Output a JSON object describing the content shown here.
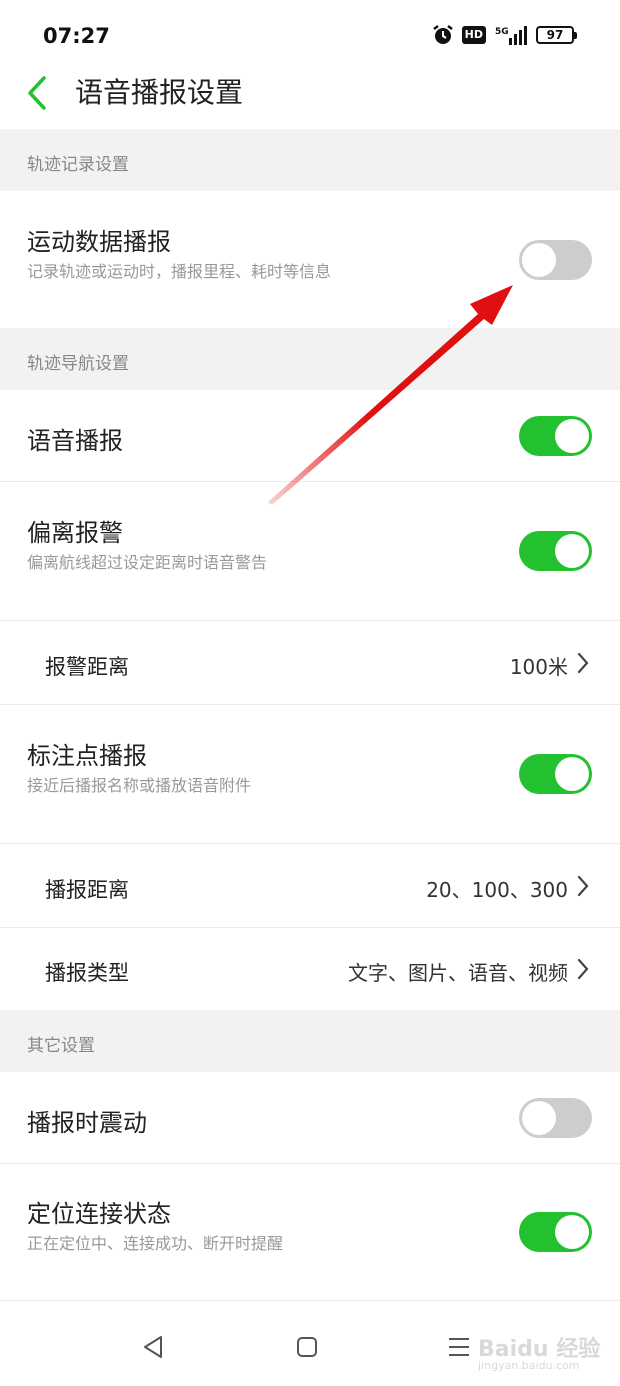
{
  "status_bar": {
    "time": "07:27",
    "hd_label": "HD",
    "network_label": "5G",
    "battery_level": "97"
  },
  "header": {
    "title": "语音播报设置"
  },
  "sections": {
    "track_record": "轨迹记录设置",
    "track_nav": "轨迹导航设置",
    "other": "其它设置"
  },
  "rows": {
    "sport_data": {
      "title": "运动数据播报",
      "subtitle": "记录轨迹或运动时，播报里程、耗时等信息",
      "enabled": false
    },
    "voice_broadcast": {
      "title": "语音播报",
      "enabled": true
    },
    "deviation_alarm": {
      "title": "偏离报警",
      "subtitle": "偏离航线超过设定距离时语音警告",
      "enabled": true
    },
    "alarm_distance": {
      "title": "报警距离",
      "value": "100米"
    },
    "marker_broadcast": {
      "title": "标注点播报",
      "subtitle": "接近后播报名称或播放语音附件",
      "enabled": true
    },
    "broadcast_distance": {
      "title": "播报距离",
      "value": "20、100、300"
    },
    "broadcast_type": {
      "title": "播报类型",
      "value": "文字、图片、语音、视频"
    },
    "vibrate": {
      "title": "播报时震动",
      "enabled": false
    },
    "location_status": {
      "title": "定位连接状态",
      "subtitle": "正在定位中、连接成功、断开时提醒",
      "enabled": true
    }
  },
  "watermark": {
    "brand": "Baidu 经验",
    "url": "jingyan.baidu.com"
  },
  "colors": {
    "accent": "#23c12f",
    "toggle_off": "#cdcdcd",
    "section_bg": "#f2f2f2",
    "annotation_arrow": "#e01010"
  },
  "icons": {
    "back": "chevron-left-icon",
    "row_chevron": "chevron-right-icon",
    "alarm": "alarm-clock-icon",
    "signal": "signal-icon",
    "battery": "battery-icon",
    "nav_back": "triangle-back-icon",
    "nav_home": "square-home-icon",
    "nav_menu": "menu-lines-icon"
  }
}
